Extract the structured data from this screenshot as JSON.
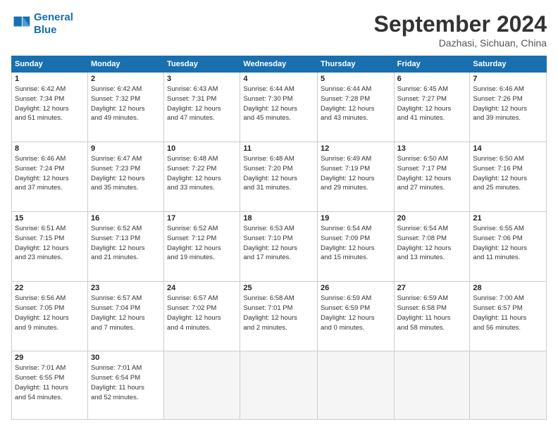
{
  "header": {
    "logo_line1": "General",
    "logo_line2": "Blue",
    "month": "September 2024",
    "location": "Dazhasi, Sichuan, China"
  },
  "weekdays": [
    "Sunday",
    "Monday",
    "Tuesday",
    "Wednesday",
    "Thursday",
    "Friday",
    "Saturday"
  ],
  "weeks": [
    [
      {
        "day": "1",
        "info": "Sunrise: 6:42 AM\nSunset: 7:34 PM\nDaylight: 12 hours\nand 51 minutes."
      },
      {
        "day": "2",
        "info": "Sunrise: 6:42 AM\nSunset: 7:32 PM\nDaylight: 12 hours\nand 49 minutes."
      },
      {
        "day": "3",
        "info": "Sunrise: 6:43 AM\nSunset: 7:31 PM\nDaylight: 12 hours\nand 47 minutes."
      },
      {
        "day": "4",
        "info": "Sunrise: 6:44 AM\nSunset: 7:30 PM\nDaylight: 12 hours\nand 45 minutes."
      },
      {
        "day": "5",
        "info": "Sunrise: 6:44 AM\nSunset: 7:28 PM\nDaylight: 12 hours\nand 43 minutes."
      },
      {
        "day": "6",
        "info": "Sunrise: 6:45 AM\nSunset: 7:27 PM\nDaylight: 12 hours\nand 41 minutes."
      },
      {
        "day": "7",
        "info": "Sunrise: 6:46 AM\nSunset: 7:26 PM\nDaylight: 12 hours\nand 39 minutes."
      }
    ],
    [
      {
        "day": "8",
        "info": "Sunrise: 6:46 AM\nSunset: 7:24 PM\nDaylight: 12 hours\nand 37 minutes."
      },
      {
        "day": "9",
        "info": "Sunrise: 6:47 AM\nSunset: 7:23 PM\nDaylight: 12 hours\nand 35 minutes."
      },
      {
        "day": "10",
        "info": "Sunrise: 6:48 AM\nSunset: 7:22 PM\nDaylight: 12 hours\nand 33 minutes."
      },
      {
        "day": "11",
        "info": "Sunrise: 6:48 AM\nSunset: 7:20 PM\nDaylight: 12 hours\nand 31 minutes."
      },
      {
        "day": "12",
        "info": "Sunrise: 6:49 AM\nSunset: 7:19 PM\nDaylight: 12 hours\nand 29 minutes."
      },
      {
        "day": "13",
        "info": "Sunrise: 6:50 AM\nSunset: 7:17 PM\nDaylight: 12 hours\nand 27 minutes."
      },
      {
        "day": "14",
        "info": "Sunrise: 6:50 AM\nSunset: 7:16 PM\nDaylight: 12 hours\nand 25 minutes."
      }
    ],
    [
      {
        "day": "15",
        "info": "Sunrise: 6:51 AM\nSunset: 7:15 PM\nDaylight: 12 hours\nand 23 minutes."
      },
      {
        "day": "16",
        "info": "Sunrise: 6:52 AM\nSunset: 7:13 PM\nDaylight: 12 hours\nand 21 minutes."
      },
      {
        "day": "17",
        "info": "Sunrise: 6:52 AM\nSunset: 7:12 PM\nDaylight: 12 hours\nand 19 minutes."
      },
      {
        "day": "18",
        "info": "Sunrise: 6:53 AM\nSunset: 7:10 PM\nDaylight: 12 hours\nand 17 minutes."
      },
      {
        "day": "19",
        "info": "Sunrise: 6:54 AM\nSunset: 7:09 PM\nDaylight: 12 hours\nand 15 minutes."
      },
      {
        "day": "20",
        "info": "Sunrise: 6:54 AM\nSunset: 7:08 PM\nDaylight: 12 hours\nand 13 minutes."
      },
      {
        "day": "21",
        "info": "Sunrise: 6:55 AM\nSunset: 7:06 PM\nDaylight: 12 hours\nand 11 minutes."
      }
    ],
    [
      {
        "day": "22",
        "info": "Sunrise: 6:56 AM\nSunset: 7:05 PM\nDaylight: 12 hours\nand 9 minutes."
      },
      {
        "day": "23",
        "info": "Sunrise: 6:57 AM\nSunset: 7:04 PM\nDaylight: 12 hours\nand 7 minutes."
      },
      {
        "day": "24",
        "info": "Sunrise: 6:57 AM\nSunset: 7:02 PM\nDaylight: 12 hours\nand 4 minutes."
      },
      {
        "day": "25",
        "info": "Sunrise: 6:58 AM\nSunset: 7:01 PM\nDaylight: 12 hours\nand 2 minutes."
      },
      {
        "day": "26",
        "info": "Sunrise: 6:59 AM\nSunset: 6:59 PM\nDaylight: 12 hours\nand 0 minutes."
      },
      {
        "day": "27",
        "info": "Sunrise: 6:59 AM\nSunset: 6:58 PM\nDaylight: 11 hours\nand 58 minutes."
      },
      {
        "day": "28",
        "info": "Sunrise: 7:00 AM\nSunset: 6:57 PM\nDaylight: 11 hours\nand 56 minutes."
      }
    ],
    [
      {
        "day": "29",
        "info": "Sunrise: 7:01 AM\nSunset: 6:55 PM\nDaylight: 11 hours\nand 54 minutes."
      },
      {
        "day": "30",
        "info": "Sunrise: 7:01 AM\nSunset: 6:54 PM\nDaylight: 11 hours\nand 52 minutes."
      },
      {
        "day": "",
        "info": ""
      },
      {
        "day": "",
        "info": ""
      },
      {
        "day": "",
        "info": ""
      },
      {
        "day": "",
        "info": ""
      },
      {
        "day": "",
        "info": ""
      }
    ]
  ]
}
